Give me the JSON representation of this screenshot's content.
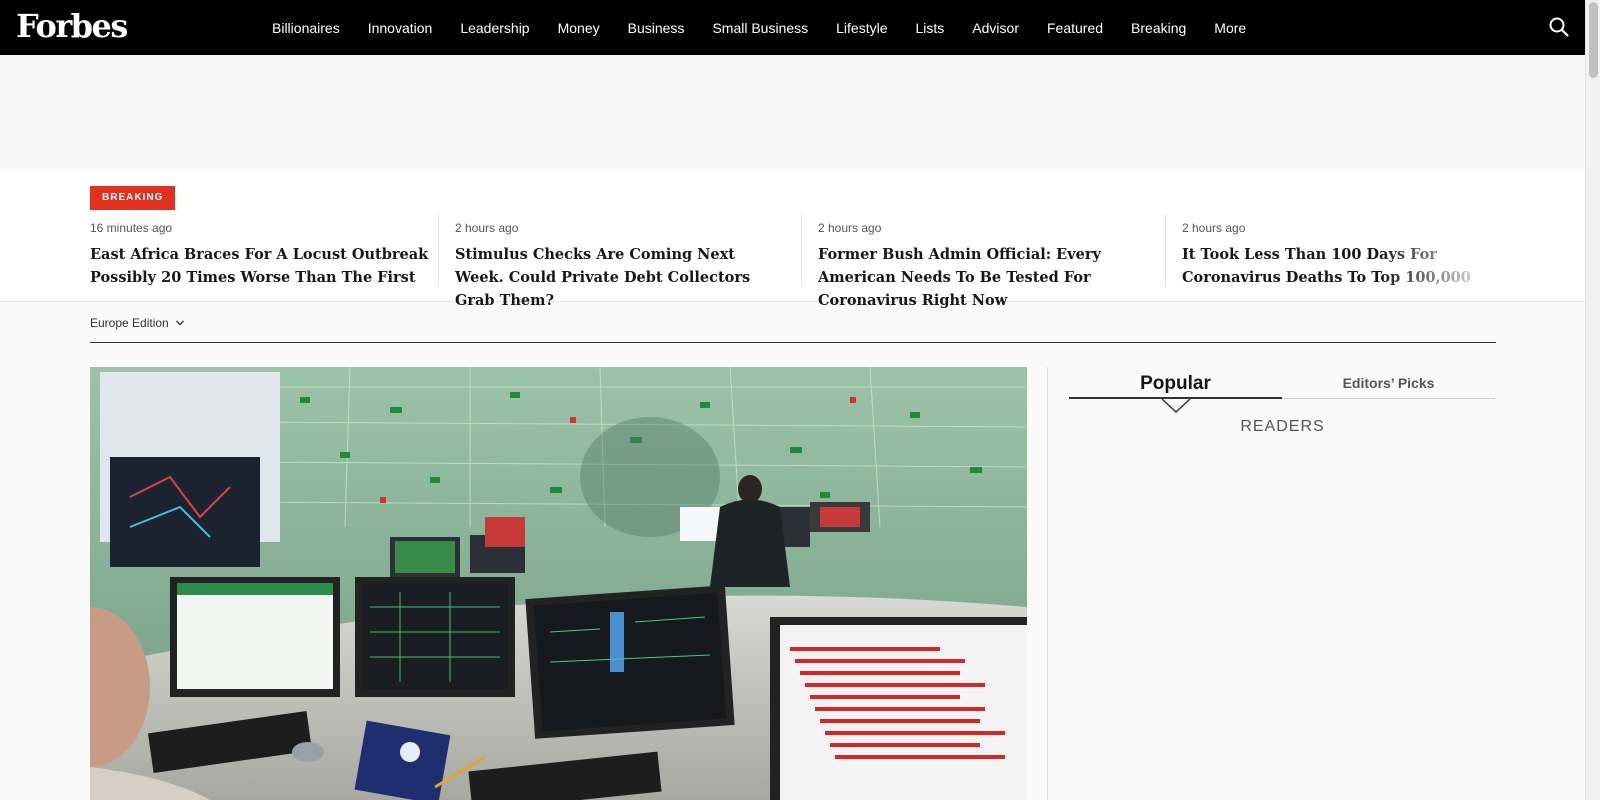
{
  "header": {
    "logo": "Forbes",
    "nav": [
      "Billionaires",
      "Innovation",
      "Leadership",
      "Money",
      "Business",
      "Small Business",
      "Lifestyle",
      "Lists",
      "Advisor",
      "Featured",
      "Breaking",
      "More"
    ],
    "search_icon": "search-icon"
  },
  "breaking": {
    "badge": "BREAKING",
    "stories": [
      {
        "time": "16 minutes ago",
        "headline": "East Africa Braces For A Locust Outbreak Possibly 20 Times Worse Than The First"
      },
      {
        "time": "2 hours ago",
        "headline": "Stimulus Checks Are Coming Next Week. Could Private Debt Collectors Grab Them?"
      },
      {
        "time": "2 hours ago",
        "headline": "Former Bush Admin Official: Every American Needs To Be Tested For Coronavirus Right Now"
      },
      {
        "time": "2 hours ago",
        "headline": "It Took Less Than 100 Days For Coronavirus Deaths To Top 100,000"
      }
    ]
  },
  "edition": {
    "label": "Europe Edition",
    "icon": "chevron-down-icon"
  },
  "sidebar": {
    "tabs": [
      "Popular",
      "Editors’ Picks"
    ],
    "active_tab": "Popular",
    "section_label": "READERS"
  },
  "colors": {
    "nav_bg": "#000000",
    "breaking_badge": "#e0301e",
    "page_bg": "#fafafa"
  }
}
